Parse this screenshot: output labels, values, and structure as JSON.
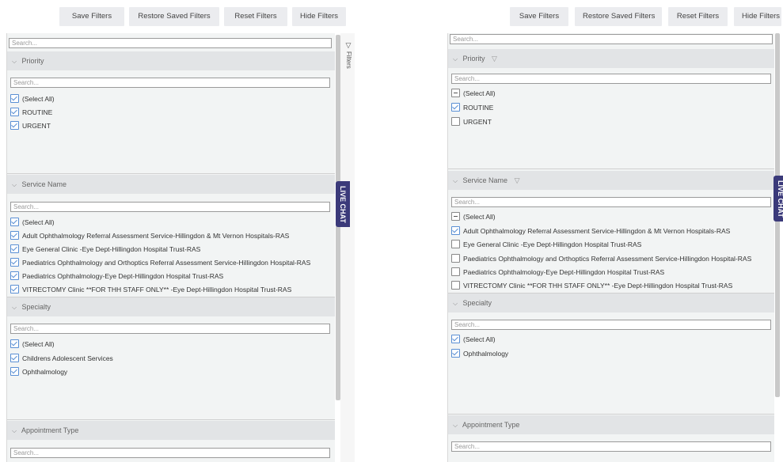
{
  "toolbar": {
    "save": "Save Filters",
    "restore": "Restore Saved Filters",
    "reset": "Reset Filters",
    "hide": "Hide Filters"
  },
  "filters_tab_label": "Filters",
  "live_chat_label": "LIVE CHAT",
  "search_placeholder": "Search...",
  "left": {
    "priority": {
      "title": "Priority",
      "items": [
        {
          "label": "(Select All)",
          "state": "checked"
        },
        {
          "label": "ROUTINE",
          "state": "checked"
        },
        {
          "label": "URGENT",
          "state": "checked"
        }
      ]
    },
    "service": {
      "title": "Service Name",
      "items": [
        {
          "label": "(Select All)",
          "state": "checked"
        },
        {
          "label": "Adult Ophthalmology Referral Assessment Service-Hillingdon & Mt Vernon Hospitals-RAS",
          "state": "checked"
        },
        {
          "label": "Eye General Clinic -Eye Dept-Hillingdon Hospital Trust-RAS",
          "state": "checked"
        },
        {
          "label": "Paediatrics Ophthalmology and Orthoptics Referral Assessment Service-Hillingdon Hospital-RAS",
          "state": "checked"
        },
        {
          "label": "Paediatrics Ophthalmology-Eye Dept-Hillingdon Hospital Trust-RAS",
          "state": "checked"
        },
        {
          "label": "VITRECTOMY Clinic **FOR THH STAFF ONLY** -Eye Dept-Hillingdon Hospital Trust-RAS",
          "state": "checked"
        }
      ]
    },
    "specialty": {
      "title": "Specialty",
      "items": [
        {
          "label": "(Select All)",
          "state": "checked"
        },
        {
          "label": "Childrens Adolescent Services",
          "state": "checked"
        },
        {
          "label": "Ophthalmology",
          "state": "checked"
        }
      ]
    },
    "appointment": {
      "title": "Appointment Type"
    }
  },
  "right": {
    "priority": {
      "title": "Priority",
      "items": [
        {
          "label": "(Select All)",
          "state": "partial"
        },
        {
          "label": "ROUTINE",
          "state": "checked"
        },
        {
          "label": "URGENT",
          "state": "unchecked"
        }
      ]
    },
    "service": {
      "title": "Service Name",
      "items": [
        {
          "label": "(Select All)",
          "state": "partial"
        },
        {
          "label": "Adult Ophthalmology Referral Assessment Service-Hillingdon & Mt Vernon Hospitals-RAS",
          "state": "checked"
        },
        {
          "label": "Eye General Clinic -Eye Dept-Hillingdon Hospital Trust-RAS",
          "state": "unchecked"
        },
        {
          "label": "Paediatrics Ophthalmology and Orthoptics Referral Assessment Service-Hillingdon Hospital-RAS",
          "state": "unchecked"
        },
        {
          "label": "Paediatrics Ophthalmology-Eye Dept-Hillingdon Hospital Trust-RAS",
          "state": "unchecked"
        },
        {
          "label": "VITRECTOMY Clinic **FOR THH STAFF ONLY** -Eye Dept-Hillingdon Hospital Trust-RAS",
          "state": "unchecked"
        }
      ]
    },
    "specialty": {
      "title": "Specialty",
      "items": [
        {
          "label": "(Select All)",
          "state": "checked"
        },
        {
          "label": "Ophthalmology",
          "state": "checked"
        }
      ]
    },
    "appointment": {
      "title": "Appointment Type"
    }
  },
  "colors": {
    "accent": "#5a8fd4",
    "live_chat_bg": "#3b3a7a",
    "section_header_bg": "#e2e4e6",
    "panel_bg": "#f2f4f4"
  },
  "icons": [
    "chevron-down-icon",
    "funnel-icon",
    "checkbox-icon"
  ]
}
